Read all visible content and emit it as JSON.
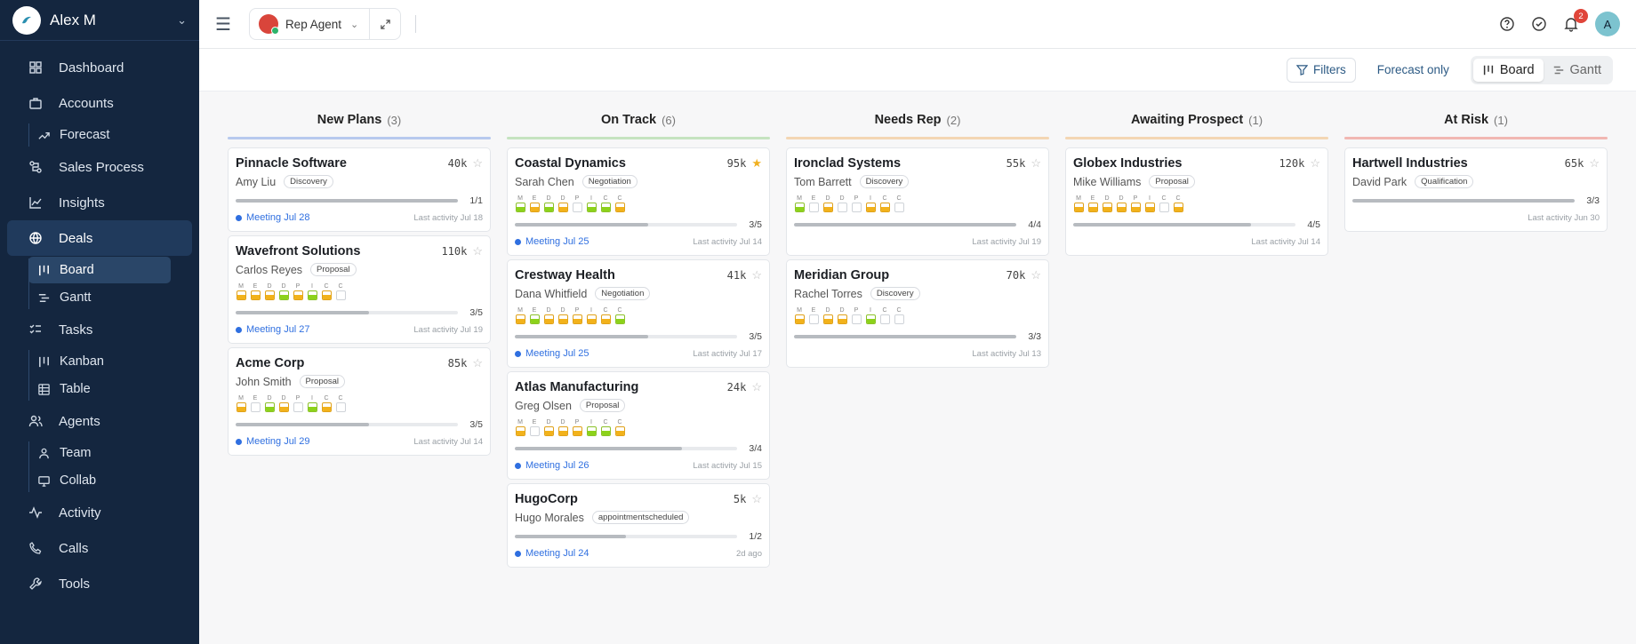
{
  "sidebar": {
    "user_name": "Alex M",
    "nav": {
      "dashboard": "Dashboard",
      "accounts": "Accounts",
      "forecast": "Forecast",
      "sales_process": "Sales Process",
      "insights": "Insights",
      "deals": "Deals",
      "board": "Board",
      "gantt": "Gantt",
      "tasks": "Tasks",
      "kanban": "Kanban",
      "table": "Table",
      "agents": "Agents",
      "team": "Team",
      "collab": "Collab",
      "activity": "Activity",
      "calls": "Calls",
      "tools": "Tools"
    }
  },
  "topbar": {
    "agent_label": "Rep Agent",
    "notification_count": "2",
    "avatar_initial": "A"
  },
  "toolbar": {
    "filters": "Filters",
    "forecast_only": "Forecast only",
    "board": "Board",
    "gantt": "Gantt"
  },
  "meddic_letters": [
    "M",
    "E",
    "D",
    "D",
    "P",
    "I",
    "C",
    "C"
  ],
  "columns": [
    {
      "title": "New Plans",
      "count": "(3)",
      "color": "#b7c9ee",
      "cards": [
        {
          "name": "Pinnacle Software",
          "amount": "40k",
          "starred": false,
          "person": "Amy Liu",
          "stage": "Discovery",
          "meddic": null,
          "progress": 1.0,
          "progress_label": "1/1",
          "meeting": "Meeting Jul 28",
          "last": "Last activity Jul 18"
        },
        {
          "name": "Wavefront Solutions",
          "amount": "110k",
          "starred": false,
          "person": "Carlos Reyes",
          "stage": "Proposal",
          "meddic": [
            "y",
            "y",
            "y",
            "g",
            "y",
            "g",
            "y",
            "n"
          ],
          "progress": 0.6,
          "progress_label": "3/5",
          "meeting": "Meeting Jul 27",
          "last": "Last activity Jul 19"
        },
        {
          "name": "Acme Corp",
          "amount": "85k",
          "starred": false,
          "person": "John Smith",
          "stage": "Proposal",
          "meddic": [
            "y",
            "n",
            "g",
            "y",
            "n",
            "g",
            "y",
            "n"
          ],
          "progress": 0.6,
          "progress_label": "3/5",
          "meeting": "Meeting Jul 29",
          "last": "Last activity Jul 14"
        }
      ]
    },
    {
      "title": "On Track",
      "count": "(6)",
      "color": "#c5e3c0",
      "cards": [
        {
          "name": "Coastal Dynamics",
          "amount": "95k",
          "starred": true,
          "person": "Sarah Chen",
          "stage": "Negotiation",
          "meddic": [
            "g",
            "y",
            "g",
            "y",
            "n",
            "g",
            "g",
            "y"
          ],
          "progress": 0.6,
          "progress_label": "3/5",
          "meeting": "Meeting Jul 25",
          "last": "Last activity Jul 14"
        },
        {
          "name": "Crestway Health",
          "amount": "41k",
          "starred": false,
          "person": "Dana Whitfield",
          "stage": "Negotiation",
          "meddic": [
            "y",
            "g",
            "y",
            "y",
            "y",
            "y",
            "y",
            "g"
          ],
          "progress": 0.6,
          "progress_label": "3/5",
          "meeting": "Meeting Jul 25",
          "last": "Last activity Jul 17"
        },
        {
          "name": "Atlas Manufacturing",
          "amount": "24k",
          "starred": false,
          "person": "Greg Olsen",
          "stage": "Proposal",
          "meddic": [
            "y",
            "n",
            "y",
            "y",
            "y",
            "g",
            "g",
            "y"
          ],
          "progress": 0.75,
          "progress_label": "3/4",
          "meeting": "Meeting Jul 26",
          "last": "Last activity Jul 15"
        },
        {
          "name": "HugoCorp",
          "amount": "5k",
          "starred": false,
          "person": "Hugo Morales",
          "stage": "appointmentscheduled",
          "meddic": null,
          "progress": 0.5,
          "progress_label": "1/2",
          "meeting": "Meeting Jul 24",
          "last": "2d ago"
        }
      ]
    },
    {
      "title": "Needs Rep",
      "count": "(2)",
      "color": "#f3d6b3",
      "cards": [
        {
          "name": "Ironclad Systems",
          "amount": "55k",
          "starred": false,
          "person": "Tom Barrett",
          "stage": "Discovery",
          "meddic": [
            "g",
            "n",
            "y",
            "n",
            "n",
            "y",
            "y",
            "n"
          ],
          "progress": 1.0,
          "progress_label": "4/4",
          "meeting": "",
          "last": "Last activity Jul 19"
        },
        {
          "name": "Meridian Group",
          "amount": "70k",
          "starred": false,
          "person": "Rachel Torres",
          "stage": "Discovery",
          "meddic": [
            "y",
            "n",
            "y",
            "y",
            "n",
            "g",
            "n",
            "n"
          ],
          "progress": 1.0,
          "progress_label": "3/3",
          "meeting": "",
          "last": "Last activity Jul 13"
        }
      ]
    },
    {
      "title": "Awaiting Prospect",
      "count": "(1)",
      "color": "#f3d6b3",
      "cards": [
        {
          "name": "Globex Industries",
          "amount": "120k",
          "starred": false,
          "person": "Mike Williams",
          "stage": "Proposal",
          "meddic": [
            "y",
            "y",
            "y",
            "y",
            "y",
            "y",
            "n",
            "y"
          ],
          "progress": 0.8,
          "progress_label": "4/5",
          "meeting": "",
          "last": "Last activity Jul 14"
        }
      ]
    },
    {
      "title": "At Risk",
      "count": "(1)",
      "color": "#f1b7b2",
      "cards": [
        {
          "name": "Hartwell Industries",
          "amount": "65k",
          "starred": false,
          "person": "David Park",
          "stage": "Qualification",
          "meddic": null,
          "progress": 1.0,
          "progress_label": "3/3",
          "meeting": "",
          "last": "Last activity Jun 30"
        }
      ]
    }
  ]
}
